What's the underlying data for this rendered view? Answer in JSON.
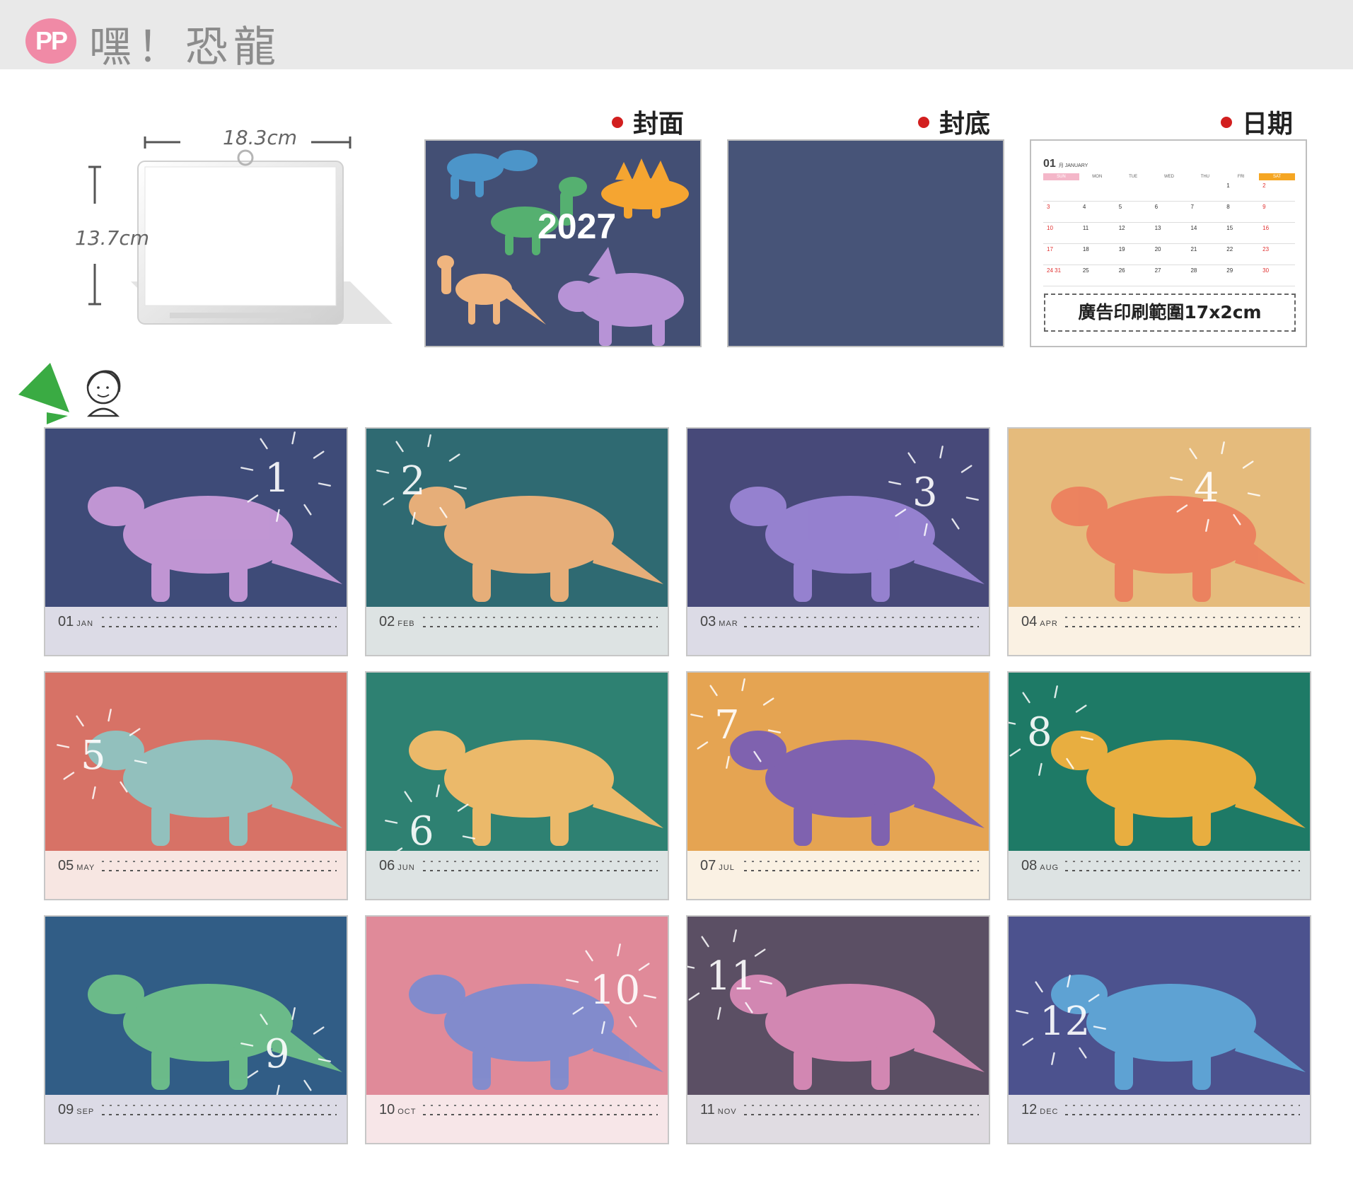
{
  "header": {
    "badge": "PP",
    "title": "嘿！恐龍"
  },
  "product": {
    "width_label": "18.3cm",
    "height_label": "13.7cm"
  },
  "panels": {
    "cover_label": "封面",
    "back_label": "封底",
    "date_label": "日期",
    "cover_year": "2027",
    "ad_box_text": "廣告印刷範圍17x2cm",
    "date_sheet": {
      "month_num": "01",
      "month_name": "月 JANUARY",
      "weekdays": [
        "SUN",
        "MON",
        "TUE",
        "WED",
        "THU",
        "FRI",
        "SAT"
      ],
      "weeks": [
        [
          "",
          "",
          "",
          "",
          "",
          "1",
          "2"
        ],
        [
          "3",
          "4",
          "5",
          "6",
          "7",
          "8",
          "9"
        ],
        [
          "10",
          "11",
          "12",
          "13",
          "14",
          "15",
          "16"
        ],
        [
          "17",
          "18",
          "19",
          "20",
          "21",
          "22",
          "23"
        ],
        [
          "24 31",
          "25",
          "26",
          "27",
          "28",
          "29",
          "30"
        ]
      ]
    }
  },
  "months": [
    {
      "num": "01",
      "abbr": "JAN",
      "hand": "1",
      "art_color": "#3e4b78",
      "strip_color": "#dcdbe6",
      "dino": "triceratops-icon",
      "dino_color": "#c89ad8"
    },
    {
      "num": "02",
      "abbr": "FEB",
      "hand": "2",
      "art_color": "#2f6a72",
      "strip_color": "#dde3e3",
      "dino": "iguanodon-icon",
      "dino_color": "#f0b27a"
    },
    {
      "num": "03",
      "abbr": "MAR",
      "hand": "3",
      "art_color": "#474979",
      "strip_color": "#dcdbe6",
      "dino": "parasaurolophus-icon",
      "dino_color": "#9a84d4"
    },
    {
      "num": "04",
      "abbr": "APR",
      "hand": "4",
      "art_color": "#e5bb7c",
      "strip_color": "#faf1e3",
      "dino": "allosaurus-icon",
      "dino_color": "#ec7f5e"
    },
    {
      "num": "05",
      "abbr": "MAY",
      "hand": "5",
      "art_color": "#d77266",
      "strip_color": "#f7e6e2",
      "dino": "brachiosaurus-icon",
      "dino_color": "#8fc5c2"
    },
    {
      "num": "06",
      "abbr": "JUN",
      "hand": "6",
      "art_color": "#2e8172",
      "strip_color": "#dde3e3",
      "dino": "spinosaurus-icon",
      "dino_color": "#f6bd6a"
    },
    {
      "num": "07",
      "abbr": "JUL",
      "hand": "7",
      "art_color": "#e5a452",
      "strip_color": "#faf1e3",
      "dino": "pteranodon-icon",
      "dino_color": "#7a5fb4"
    },
    {
      "num": "08",
      "abbr": "AUG",
      "hand": "8",
      "art_color": "#1e7a66",
      "strip_color": "#dde3e3",
      "dino": "stegosaurus-icon",
      "dino_color": "#f3b13e"
    },
    {
      "num": "09",
      "abbr": "SEP",
      "hand": "9",
      "art_color": "#315d86",
      "strip_color": "#dcdbe6",
      "dino": "t-rex-icon",
      "dino_color": "#6fc08a"
    },
    {
      "num": "10",
      "abbr": "OCT",
      "hand": "10",
      "art_color": "#e08a99",
      "strip_color": "#f7e6e8",
      "dino": "pachycephalosaurus-icon",
      "dino_color": "#7e8ccf"
    },
    {
      "num": "11",
      "abbr": "NOV",
      "hand": "11",
      "art_color": "#5b4f64",
      "strip_color": "#e0dce2",
      "dino": "ankylosaurus-icon",
      "dino_color": "#d98ab7"
    },
    {
      "num": "12",
      "abbr": "DEC",
      "hand": "12",
      "art_color": "#4c528e",
      "strip_color": "#dcdbe6",
      "dino": "carnotaurus-icon",
      "dino_color": "#5fa7d7"
    }
  ]
}
